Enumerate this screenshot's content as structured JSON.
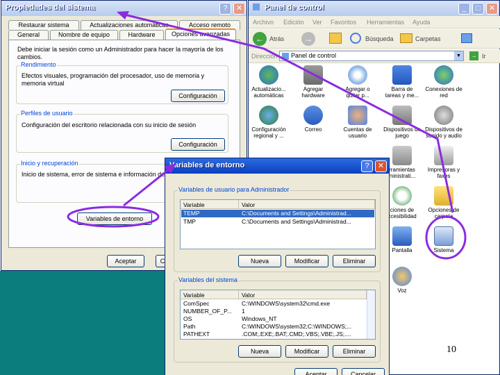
{
  "page_number": "10",
  "props": {
    "title": "Propiedades del sistema",
    "tabs_row1": [
      "Restaurar sistema",
      "Actualizaciones automáticas",
      "Acceso remoto"
    ],
    "tabs_row2": [
      "General",
      "Nombre de equipo",
      "Hardware",
      "Opciones avanzadas"
    ],
    "intro": "Debe iniciar la sesión como un Administrador para hacer la mayoría de los cambios.",
    "perf_label": "Rendimiento",
    "perf_text": "Efectos visuales, programación del procesador, uso de memoria y memoria virtual",
    "profiles_label": "Perfiles de usuario",
    "profiles_text": "Configuración del escritorio relacionada con su inicio de sesión",
    "startup_label": "Inicio y recuperación",
    "startup_text": "Inicio de sistema, error de sistema e información de",
    "config_button": "Configuración",
    "env_button": "Variables de entorno",
    "accept_button": "Aceptar",
    "cancel_partial": "C",
    "help_glyph": "?",
    "close_glyph": "✕"
  },
  "cp": {
    "title": "Panel de control",
    "menu": [
      "Archivo",
      "Edición",
      "Ver",
      "Favoritos",
      "Herramientas",
      "Ayuda"
    ],
    "back": "Atrás",
    "search": "Búsqueda",
    "folders": "Carpetas",
    "address_label": "Dirección",
    "address_value": "Panel de control",
    "go": "Ir",
    "items": [
      {
        "l1": "Actualizacio...",
        "l2": "automáticas",
        "icon": "globe-icon"
      },
      {
        "l1": "Agregar",
        "l2": "hardware",
        "icon": "hardware-icon"
      },
      {
        "l1": "Agregar o",
        "l2": "quitar p...",
        "icon": "cd-icon"
      },
      {
        "l1": "Barra de",
        "l2": "tareas y me...",
        "icon": "taskbar-icon"
      },
      {
        "l1": "Conexiones de",
        "l2": "red",
        "icon": "network-icon"
      },
      {
        "l1": "Configuración",
        "l2": "regional y ...",
        "icon": "regional-icon"
      },
      {
        "l1": "Correo",
        "l2": "",
        "icon": "mail-icon"
      },
      {
        "l1": "Cuentas de",
        "l2": "usuario",
        "icon": "users-icon"
      },
      {
        "l1": "Dispositivos de",
        "l2": "juego",
        "icon": "gamepad-icon"
      },
      {
        "l1": "Dispositivos de",
        "l2": "sonido y audio",
        "icon": "speaker-icon"
      },
      {
        "l1": "rramientas",
        "l2": "ministrati...",
        "icon": "tools-icon"
      },
      {
        "l1": "Impresoras y",
        "l2": "faxes",
        "icon": "printer-icon"
      },
      {
        "l1": "ciones de",
        "l2": "ccesibilidad",
        "icon": "accessibility-icon"
      },
      {
        "l1": "Opciones de",
        "l2": "carpeta",
        "icon": "folder-icon"
      },
      {
        "l1": "Pantalla",
        "l2": "",
        "icon": "display-icon"
      },
      {
        "l1": "Sistema",
        "l2": "",
        "icon": "system-icon"
      },
      {
        "l1": "Voz",
        "l2": "",
        "icon": "voice-icon"
      }
    ]
  },
  "env": {
    "title": "Variables de entorno",
    "user_group": "Variables de usuario para Administrador",
    "sys_group": "Variables del sistema",
    "col_var": "Variable",
    "col_val": "Valor",
    "user_vars": [
      {
        "name": "TEMP",
        "value": "C:\\Documents and Settings\\Administrad..."
      },
      {
        "name": "TMP",
        "value": "C:\\Documents and Settings\\Administrad..."
      }
    ],
    "sys_vars": [
      {
        "name": "ComSpec",
        "value": "C:\\WINDOWS\\system32\\cmd.exe"
      },
      {
        "name": "NUMBER_OF_P...",
        "value": "1"
      },
      {
        "name": "OS",
        "value": "Windows_NT"
      },
      {
        "name": "Path",
        "value": "C:\\WINDOWS\\system32;C:\\WINDOWS;..."
      },
      {
        "name": "PATHEXT",
        "value": ".COM;.EXE;.BAT;.CMD;.VBS;.VBE;.JS;...."
      }
    ],
    "new_button": "Nueva",
    "edit_button": "Modificar",
    "delete_button": "Eliminar",
    "accept_button": "Aceptar",
    "cancel_button": "Cancelar"
  },
  "colors": {
    "annotation": "#8a2be2",
    "title_active": "#0a3fc2",
    "desktop": "#0b7d7d"
  }
}
